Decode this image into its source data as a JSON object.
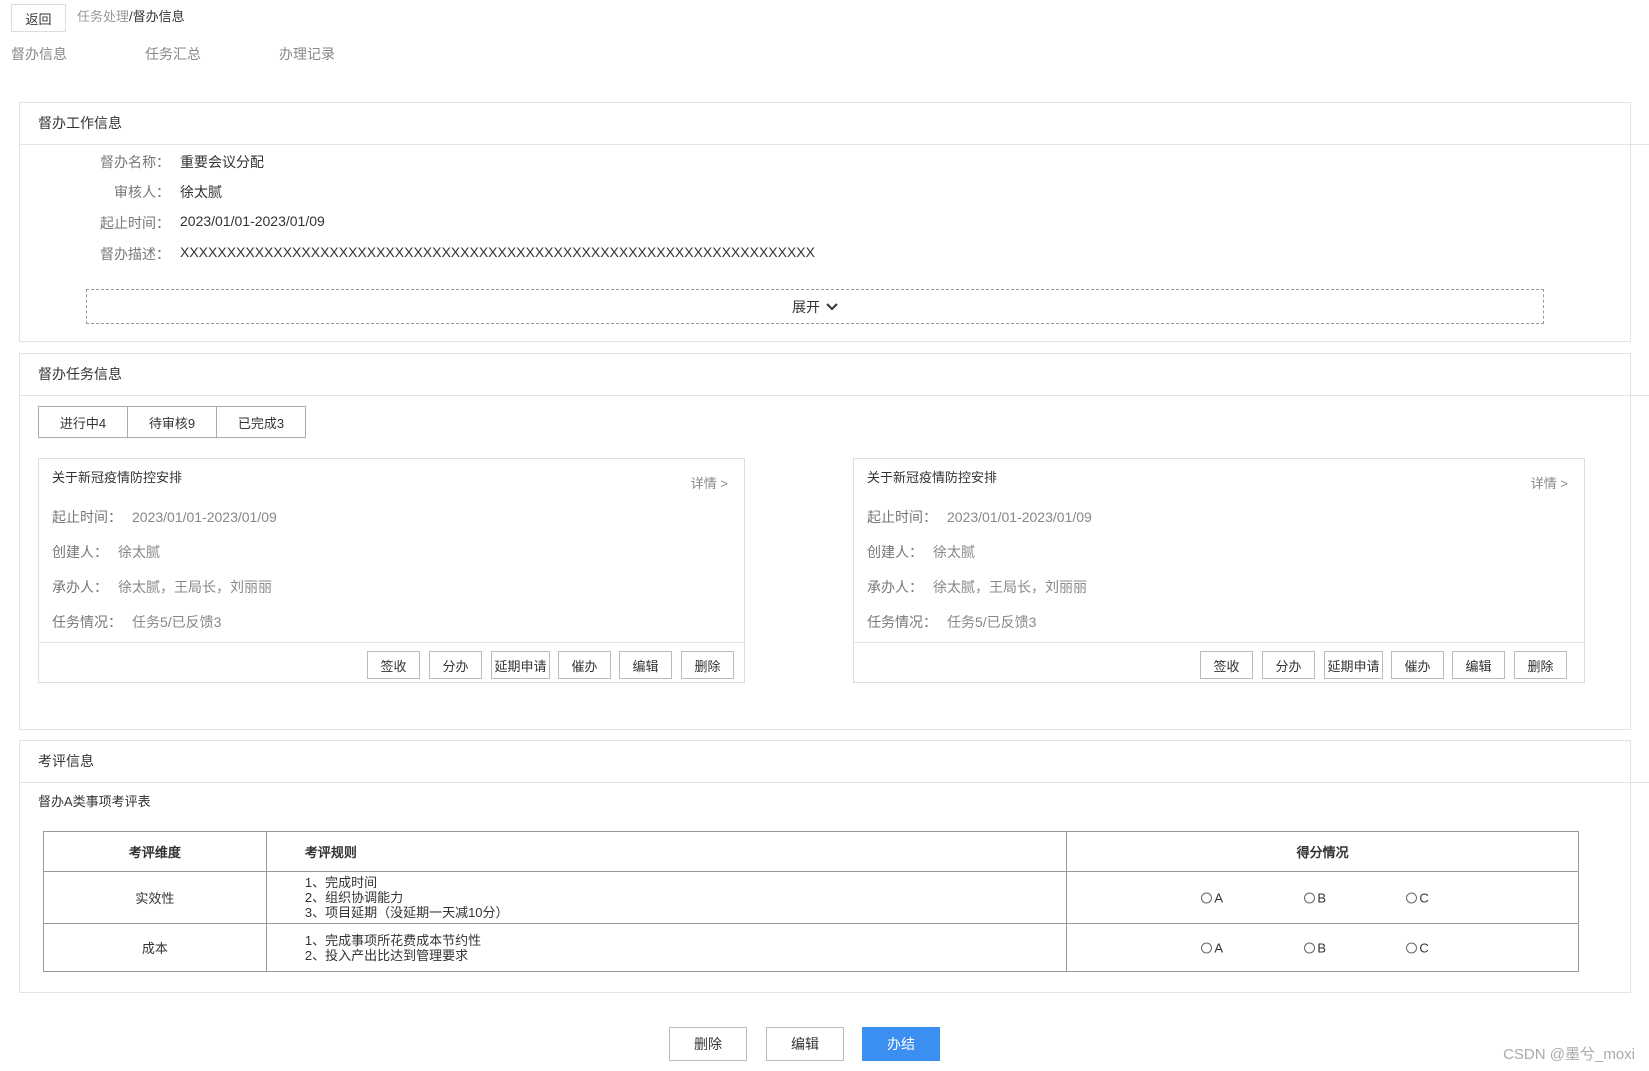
{
  "header": {
    "back_label": "返回",
    "breadcrumb_parent": "任务处理",
    "breadcrumb_separator": "/",
    "breadcrumb_current": "督办信息"
  },
  "top_tabs": [
    "督办信息",
    "任务汇总",
    "办理记录"
  ],
  "work_info": {
    "title": "督办工作信息",
    "rows": [
      {
        "label": "督办名称：",
        "value": "重要会议分配"
      },
      {
        "label": "审核人：",
        "value": "徐太腻"
      },
      {
        "label": "起止时间：",
        "value": "2023/01/01-2023/01/09"
      },
      {
        "label": "督办描述：",
        "value": "XXXXXXXXXXXXXXXXXXXXXXXXXXXXXXXXXXXXXXXXXXXXXXXXXXXXXXXXXXXXXXXXXXXX"
      }
    ],
    "expand_label": "展开",
    "expand_icon": "chevron-down-icon"
  },
  "task_info": {
    "title": "督办任务信息",
    "status_tabs": [
      "进行中4",
      "待审核9",
      "已完成3"
    ],
    "cards": [
      {
        "title": "关于新冠疫情防控安排",
        "detail": "详情 >",
        "rows": [
          {
            "label": "起止时间：",
            "value": "2023/01/01-2023/01/09"
          },
          {
            "label": "创建人：",
            "value": "徐太腻"
          },
          {
            "label": "承办人：",
            "value": "徐太腻，王局长，刘丽丽"
          },
          {
            "label": "任务情况：",
            "value": "任务5/已反馈3"
          }
        ],
        "actions": [
          "签收",
          "分办",
          "延期申请",
          "催办",
          "编辑",
          "删除"
        ]
      },
      {
        "title": "关于新冠疫情防控安排",
        "detail": "详情 >",
        "rows": [
          {
            "label": "起止时间：",
            "value": "2023/01/01-2023/01/09"
          },
          {
            "label": "创建人：",
            "value": "徐太腻"
          },
          {
            "label": "承办人：",
            "value": "徐太腻，王局长，刘丽丽"
          },
          {
            "label": "任务情况：",
            "value": "任务5/已反馈3"
          }
        ],
        "actions": [
          "签收",
          "分办",
          "延期申请",
          "催办",
          "编辑",
          "删除"
        ]
      }
    ]
  },
  "eval_info": {
    "title": "考评信息",
    "table_title": "督办A类事项考评表",
    "headers": [
      "考评维度",
      "考评规则",
      "得分情况"
    ],
    "rows": [
      {
        "dimension": "实效性",
        "rules": [
          "1、完成时间",
          "2、组织协调能力",
          "3、项目延期（没延期一天减10分）"
        ],
        "options": [
          "A",
          "B",
          "C"
        ]
      },
      {
        "dimension": "成本",
        "rules": [
          "1、完成事项所花费成本节约性",
          "2、投入产出比达到管理要求"
        ],
        "options": [
          "A",
          "B",
          "C"
        ]
      }
    ]
  },
  "footer": {
    "delete_label": "删除",
    "edit_label": "编辑",
    "finish_label": "办结",
    "primary_color": "#3b8ff0"
  },
  "watermark": "CSDN @墨兮_moxi"
}
